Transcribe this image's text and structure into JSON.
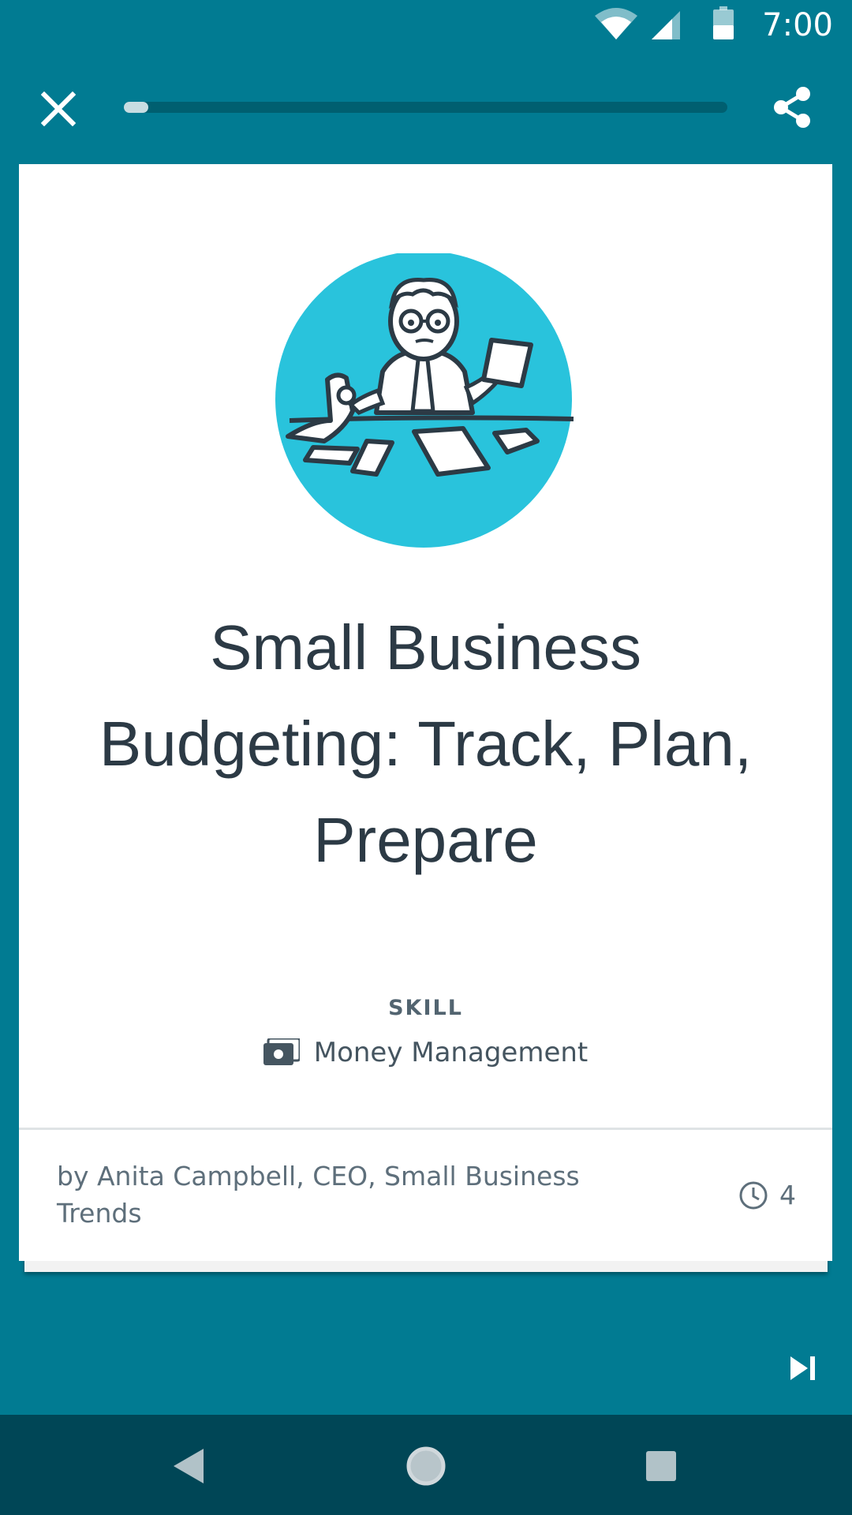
{
  "status_bar": {
    "time": "7:00",
    "icons": [
      "wifi-icon",
      "signal-icon",
      "battery-icon"
    ]
  },
  "toolbar": {
    "close_icon": "close-icon",
    "share_icon": "share-icon",
    "progress": 0.04
  },
  "card": {
    "illustration": "worried-accountant-illustration",
    "title": "Small Business Budgeting: Track, Plan, Prepare",
    "skill_label": "SKILL",
    "skill_icon": "money-icon",
    "skill_name": "Money Management",
    "author": "by Anita Campbell, CEO, Small Business Trends",
    "duration_icon": "clock-icon",
    "duration": "4"
  },
  "skip_icon": "skip-next-icon",
  "nav_bar": {
    "icons": [
      "back-icon",
      "home-icon",
      "recents-icon"
    ]
  },
  "colors": {
    "background": "#017b92",
    "nav_bar": "#004656",
    "illustration_circle": "#29c3dc",
    "title_text": "#2c3a45"
  }
}
